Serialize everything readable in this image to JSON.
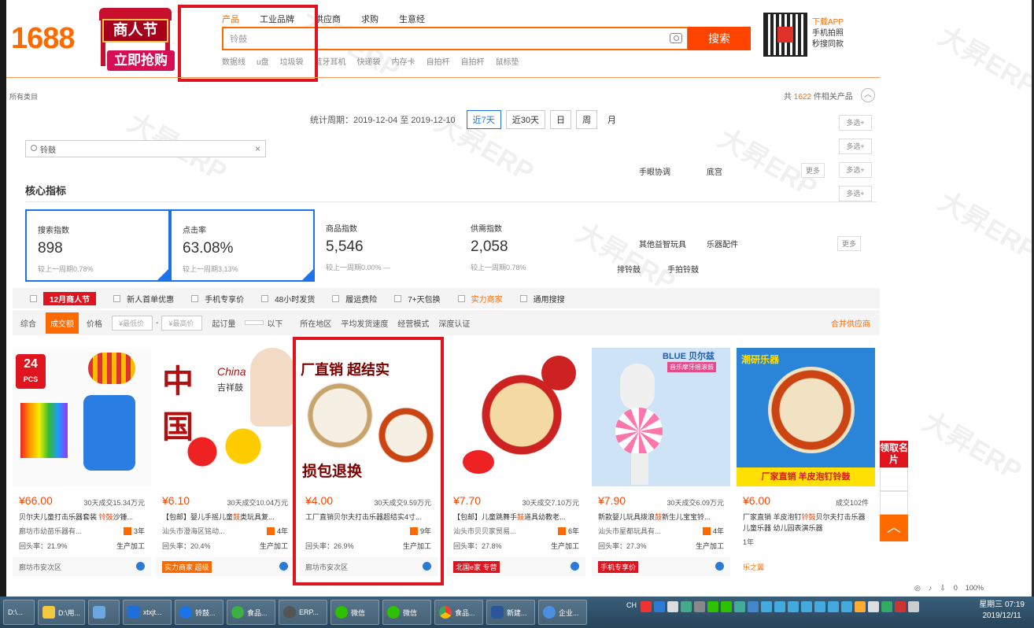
{
  "header": {
    "logo": "1688",
    "banner_sign": "商人节",
    "banner_button": "立即抢购",
    "search_tabs": [
      "产品",
      "工业品牌",
      "供应商",
      "求购",
      "生意经"
    ],
    "search_value": "铃鼓",
    "search_button": "搜索",
    "hot_words": [
      "数据线",
      "u盘",
      "垃圾袋",
      "蓝牙耳机",
      "快递袋",
      "内存卡",
      "自拍杆",
      "自拍杆",
      "鼠标垫"
    ],
    "app_title": "下载APP",
    "app_line1": "手机拍照",
    "app_line2": "秒搜同款"
  },
  "breadcrumb": "所有类目",
  "result_count": {
    "prefix": "共",
    "number": "1622",
    "suffix": "件相关产品"
  },
  "stats": {
    "period_label": "统计周期：2019-12-04 至 2019-12-10",
    "periods": [
      "近7天",
      "近30天",
      "日",
      "周",
      "月"
    ]
  },
  "sub_search": {
    "value": "铃鼓"
  },
  "multi_select": "多选+",
  "categories": {
    "row1": [
      "手眼协调",
      "底宫"
    ],
    "row2": [
      "其他益智玩具",
      "乐器配件"
    ],
    "row3": [
      "排铃鼓",
      "手拍铃鼓"
    ],
    "more": "更多"
  },
  "core": {
    "title": "核心指标",
    "metrics": [
      {
        "label": "搜索指数",
        "value": "898",
        "sub": "较上一周期0.78%"
      },
      {
        "label": "点击率",
        "value": "63.08%",
        "sub": "较上一周期3.13%"
      },
      {
        "label": "商品指数",
        "value": "5,546",
        "sub": "较上一周期0.00% —"
      },
      {
        "label": "供需指数",
        "value": "2,058",
        "sub": "较上一周期0.78%"
      }
    ]
  },
  "filters": {
    "tag": "12月商人节",
    "items": [
      "新人首单优惠",
      "手机专享价",
      "48小时发货",
      "履运费险",
      "7+天包换",
      "实力商家",
      "通用搜搜"
    ]
  },
  "sort": {
    "items": [
      "综合",
      "成交额",
      "价格"
    ],
    "price_low": "¥最低价",
    "dash": "-",
    "price_high": "¥最高价",
    "min_order": "起订量",
    "below": "以下",
    "region": "所在地区",
    "ship_speed": "平均发货速度",
    "biz_mode": "经营模式",
    "depth": "深度认证",
    "merge": "合并供应商"
  },
  "products": [
    {
      "price": "¥66.00",
      "sold": "30天成交15.34万元",
      "title_pre": "贝尔夫儿童打击乐器套装 ",
      "title_hl": "铃鼓",
      "title_post": "沙锤...",
      "company": "廊坊市幼苗乐器有...",
      "years": "3年",
      "rate": "回头率：21.9%",
      "mode": "生产加工",
      "bottom": "廊坊市安次区"
    },
    {
      "price": "¥6.10",
      "sold": "30天成交10.04万元",
      "title_pre": "【包邮】婴儿手摇儿童",
      "title_hl": "鼓",
      "title_post": "类玩具复...",
      "company": "汕头市澄海区铭动...",
      "years": "4年",
      "rate": "回头率：20.4%",
      "mode": "生产加工",
      "bottom": "实力商家 超级"
    },
    {
      "price": "¥4.00",
      "sold": "30天成交9.59万元",
      "title_pre": "工厂直销贝尔夫打击乐器超结实4寸...",
      "title_hl": "",
      "title_post": "",
      "company": "",
      "years": "9年",
      "rate": "回头率：26.9%",
      "mode": "生产加工",
      "bottom": "廊坊市安次区"
    },
    {
      "price": "¥7.70",
      "sold": "30天成交7.10万元",
      "title_pre": "【包邮】儿童跳舞手",
      "title_hl": "鼓",
      "title_post": "道具幼教老...",
      "company": "汕头市贝贝家贸易...",
      "years": "6年",
      "rate": "回头率：27.8%",
      "mode": "生产加工",
      "bottom": "北国e家 专营"
    },
    {
      "price": "¥7.90",
      "sold": "30天成交6.09万元",
      "title_pre": "新款婴儿玩具拨浪",
      "title_hl": "鼓",
      "title_post": "新生儿宝宝铃...",
      "company": "汕头市星都玩具有...",
      "years": "4年",
      "rate": "回头率：27.3%",
      "mode": "生产加工",
      "bottom": "手机专享价"
    },
    {
      "price": "¥6.00",
      "sold": "成交102件",
      "title_pre": "厂家直销 羊皮泡钉",
      "title_hl": "铃鼓",
      "title_post": "贝尔夫打击乐器 儿童乐器 幼儿园表演乐器",
      "company": "",
      "years": "1年",
      "rate": "",
      "mode": "",
      "bottom": "乐之翼"
    }
  ],
  "product_img_text": {
    "p1": "24",
    "p1b": "PCS",
    "p2": "中国",
    "p2b": "China",
    "p2c": "吉祥鼓",
    "p3a": "厂直销 超结实",
    "p3b": "损包退换",
    "p5a": "BLUE 贝尔兹",
    "p5b": "音乐摩牙摇滚鼓",
    "p6a": "潮研乐器",
    "p6b": "厂家直销 羊皮泡钉铃鼓"
  },
  "side_float": {
    "top": "领取名片",
    "up": "︿"
  },
  "taskbar": {
    "tasks": [
      "D:\\...",
      "D:\\用...",
      "",
      "xtxjt...",
      "铃鼓...",
      "食品...",
      "ERP...",
      "微信",
      "微信",
      "食品...",
      "新建...",
      "企业..."
    ],
    "clock_time": "07:19",
    "clock_date": "2019/12/11",
    "clock_day": "星期三",
    "lang": "CH"
  },
  "tray_labels": [
    "0",
    "100%"
  ],
  "watermark": "大昇ERP",
  "colors": {
    "accent": "#ff6a00",
    "red": "#e0141e",
    "blue": "#1a73e8"
  }
}
